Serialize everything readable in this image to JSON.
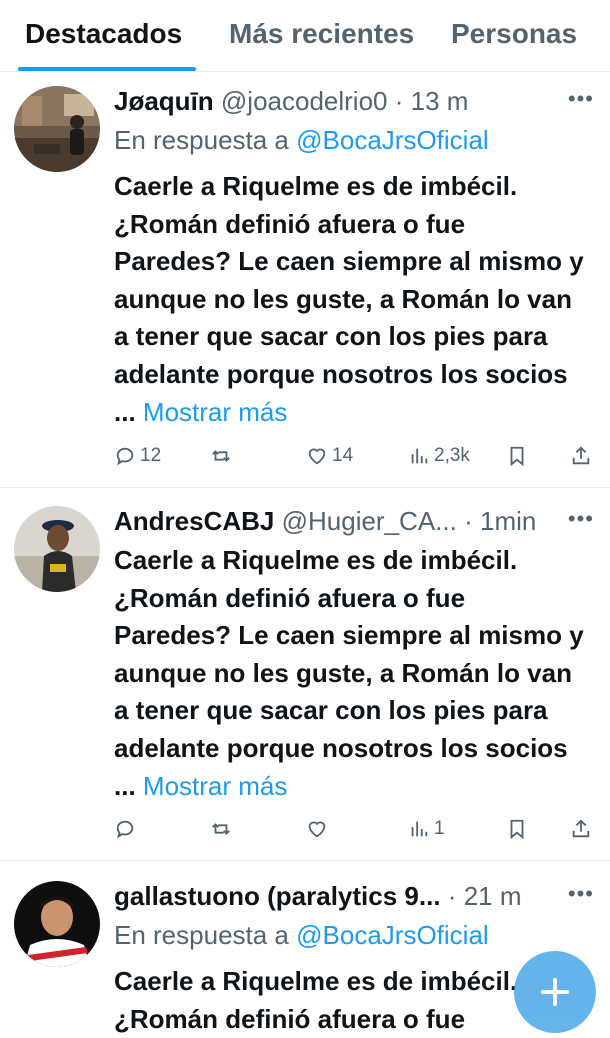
{
  "tabs": [
    {
      "label": "Destacados",
      "active": true
    },
    {
      "label": "Más recientes",
      "active": false
    },
    {
      "label": "Personas",
      "active": false
    }
  ],
  "colors": {
    "accent": "#1d9bf0",
    "text": "#0f1419",
    "muted": "#536471",
    "divider": "#e6ecf0"
  },
  "tweets": [
    {
      "name": "Jøaquīn",
      "handle": "@joacodelrio0",
      "dot": "·",
      "time": "13 m",
      "reply_prefix": "En respuesta a",
      "reply_to": "@BocaJrsOficial",
      "text": "Caerle a Riquelme es de imbécil. ¿Román definió afuera o fue Paredes? Le caen siempre al mismo y aunque no les guste, a Román lo van a tener que sacar con los pies para adelante porque nosotros los socios ...",
      "show_more": "Mostrar más",
      "replies": "12",
      "retweets": "",
      "likes": "14",
      "views": "2,3k"
    },
    {
      "name": "AndresCABJ",
      "handle": "@Hugier_CA...",
      "dot": "·",
      "time": "1min",
      "text": "Caerle a Riquelme es de imbécil. ¿Román definió afuera o fue Paredes? Le caen siempre al mismo y aunque no les guste, a Román lo van a tener que sacar con los pies para adelante porque nosotros los socios ...",
      "show_more": "Mostrar más",
      "replies": "",
      "retweets": "",
      "likes": "",
      "views": "1"
    },
    {
      "name": "gallastuono (paralytics 9...",
      "handle": "",
      "dot": "·",
      "time": "21 m",
      "reply_prefix": "En respuesta a",
      "reply_to": "@BocaJrsOficial",
      "text": "Caerle a Riquelme es de imbécil. ¿Román definió afuera o fue"
    }
  ],
  "more_icon": "more-dots-icon",
  "fab": {
    "icon": "compose-plus-icon"
  }
}
